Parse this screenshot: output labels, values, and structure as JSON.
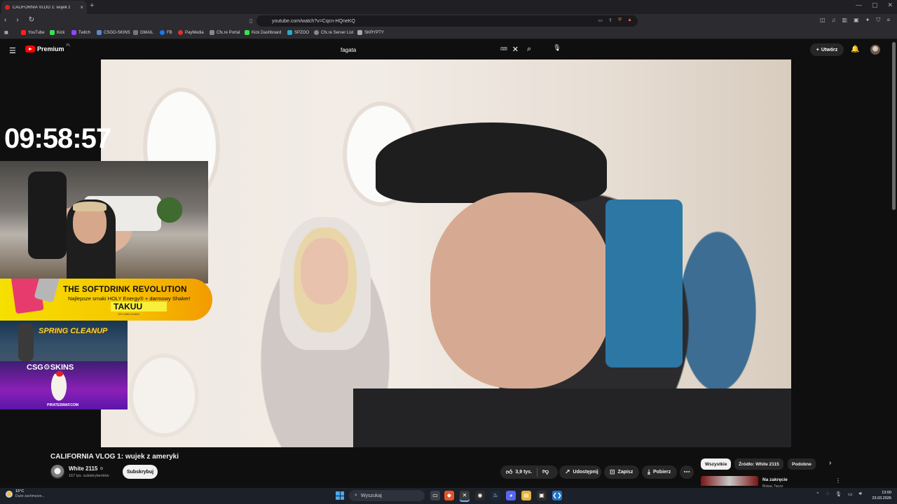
{
  "browser": {
    "tab_title": "CALIFORNIA VLOG 1: wujek z",
    "tab_close": "×",
    "new_tab": "+",
    "url": "youtube.com/watch?v=Cqcn-HQneKQ",
    "bookmarks": [
      "YouTube",
      "Kick",
      "Twitch",
      "CSGO-SKINS",
      "GMAIL",
      "FB",
      "PayMedia",
      "Cfx.re Portal",
      "Kick Dashboard",
      "SPZOO",
      "Cfx.re Server List",
      "SKRYPTY"
    ]
  },
  "youtube": {
    "brand": "Premium",
    "region": "PL",
    "search_value": "fagata",
    "create_label": "Utwórz"
  },
  "overlay": {
    "timer": "09:58:57",
    "ad1_headline": "THE SOFTDRINK REVOLUTION",
    "ad1_sub": "Najlepsze smaki HOLY Energy® + darmowy Shaker!",
    "ad1_brand": "TAKUU",
    "ad1_small": "10% zniżki z kodem",
    "ad2_text": "SPRING CLEANUP",
    "ad3_brand": "CSG⚙SKINS",
    "ad3_site": "PIRATESWAP.COM"
  },
  "video": {
    "title": "CALIFORNIA VLOG 1: wujek z ameryki",
    "channel": "White 2115",
    "subscribers": "167 tys. subskrybentów",
    "subscribe_label": "Subskrybuj",
    "likes": "3,9 tys.",
    "share_label": "Udostępnij",
    "save_label": "Zapisz",
    "download_label": "Pobierz"
  },
  "recommended": {
    "chips": [
      "Wszystkie",
      "Źródło: White 2115",
      "Podobne"
    ],
    "first_title": "Na zakręcie",
    "first_sub": "Bisiaa, Taczo"
  },
  "taskbar": {
    "temp": "15°C",
    "weather": "Duże zachmurze...",
    "search": "Wyszukaj",
    "time": "13:00",
    "date": "23.03.2026"
  }
}
